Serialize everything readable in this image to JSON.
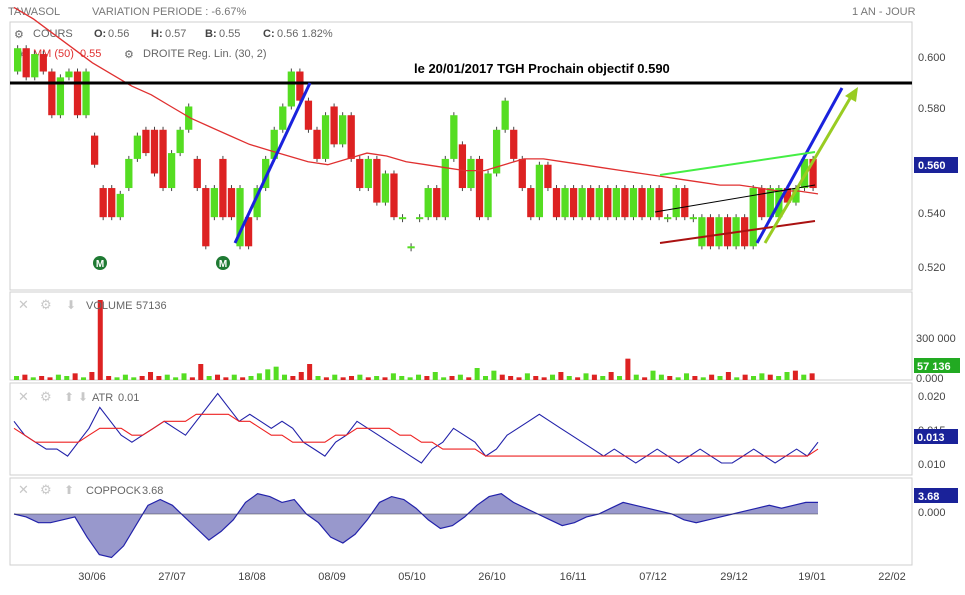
{
  "header": {
    "ticker": "TAWASOL",
    "variation": "VARIATION PERIODE : -6.67%",
    "period": "1 AN - JOUR"
  },
  "main_legend": {
    "cours": "COURS",
    "o_label": "O:",
    "o_value": "0.56",
    "h_label": "H:",
    "h_value": "0.57",
    "b_label": "B:",
    "b_value": "0.55",
    "c_label": "C:",
    "c_value": "0.56 1.82%",
    "mm": "MM (50)",
    "mm_value": "0.55",
    "droite": "DROITE Reg. Lin. (30, 2)"
  },
  "annotation": "le 20/01/2017 TGH Prochain objectif 0.590",
  "markers": [
    "M",
    "M"
  ],
  "colors": {
    "up": "#55dd22",
    "down": "#dd2222",
    "ma": "#e03030",
    "resistance": "#000000",
    "trend_blue": "#1a22dd",
    "trend_green_arrow": "#99cc22",
    "channel_top": "#44ee44",
    "channel_bottom": "#aa1111",
    "indicator_line": "#2222aa",
    "indicator_signal": "#ee2222",
    "coppock_fill": "#9898cc",
    "badge": "#1a2299",
    "badge_green": "#22aa22"
  },
  "x_ticks": [
    "30/06",
    "27/07",
    "18/08",
    "08/09",
    "05/10",
    "26/10",
    "16/11",
    "07/12",
    "29/12",
    "19/01",
    "22/02"
  ],
  "panels": {
    "price": {
      "y_ticks": [
        "0.600",
        "0.580",
        "0.560",
        "0.540",
        "0.520"
      ],
      "last": "0.560",
      "resistance": 0.59
    },
    "volume": {
      "label": "VOLUME",
      "value": "57136",
      "y_ticks": [
        "300 000",
        "0.000"
      ],
      "last": "57 136"
    },
    "atr": {
      "label": "ATR",
      "value": "0.01",
      "y_ticks": [
        "0.020",
        "0.015",
        "0.010"
      ],
      "last": "0.013"
    },
    "coppock": {
      "label": "COPPOCK",
      "value": "3.68",
      "y_ticks": [
        "0.000"
      ],
      "last": "3.68"
    }
  },
  "chart_data": {
    "type": "bar",
    "title": "TAWASOL",
    "price_ylim": [
      0.515,
      0.607
    ],
    "candles": [
      {
        "o": 0.59,
        "c": 0.598
      },
      {
        "o": 0.598,
        "c": 0.588
      },
      {
        "o": 0.588,
        "c": 0.596
      },
      {
        "o": 0.596,
        "c": 0.59
      },
      {
        "o": 0.59,
        "c": 0.575
      },
      {
        "o": 0.575,
        "c": 0.588
      },
      {
        "o": 0.588,
        "c": 0.59
      },
      {
        "o": 0.59,
        "c": 0.575
      },
      {
        "o": 0.575,
        "c": 0.59
      },
      {
        "o": 0.568,
        "c": 0.558
      },
      {
        "o": 0.55,
        "c": 0.54
      },
      {
        "o": 0.55,
        "c": 0.54
      },
      {
        "o": 0.54,
        "c": 0.548
      },
      {
        "o": 0.55,
        "c": 0.56
      },
      {
        "o": 0.56,
        "c": 0.568
      },
      {
        "o": 0.57,
        "c": 0.562
      },
      {
        "o": 0.57,
        "c": 0.555
      },
      {
        "o": 0.57,
        "c": 0.55
      },
      {
        "o": 0.55,
        "c": 0.562
      },
      {
        "o": 0.562,
        "c": 0.57
      },
      {
        "o": 0.57,
        "c": 0.578
      },
      {
        "o": 0.56,
        "c": 0.55
      },
      {
        "o": 0.55,
        "c": 0.53
      },
      {
        "o": 0.54,
        "c": 0.55
      },
      {
        "o": 0.56,
        "c": 0.54
      },
      {
        "o": 0.55,
        "c": 0.54
      },
      {
        "o": 0.53,
        "c": 0.55
      },
      {
        "o": 0.54,
        "c": 0.53
      },
      {
        "o": 0.54,
        "c": 0.55
      },
      {
        "o": 0.55,
        "c": 0.56
      },
      {
        "o": 0.56,
        "c": 0.57
      },
      {
        "o": 0.57,
        "c": 0.578
      },
      {
        "o": 0.578,
        "c": 0.59
      },
      {
        "o": 0.59,
        "c": 0.58
      },
      {
        "o": 0.58,
        "c": 0.57
      },
      {
        "o": 0.57,
        "c": 0.56
      },
      {
        "o": 0.56,
        "c": 0.575
      },
      {
        "o": 0.578,
        "c": 0.565
      },
      {
        "o": 0.565,
        "c": 0.575
      },
      {
        "o": 0.575,
        "c": 0.56
      },
      {
        "o": 0.56,
        "c": 0.55
      },
      {
        "o": 0.55,
        "c": 0.56
      },
      {
        "o": 0.56,
        "c": 0.545
      },
      {
        "o": 0.545,
        "c": 0.555
      },
      {
        "o": 0.555,
        "c": 0.54
      },
      {
        "o": 0.54,
        "c": 0.54
      },
      {
        "o": 0.53,
        "c": 0.53
      },
      {
        "o": 0.54,
        "c": 0.54
      },
      {
        "o": 0.54,
        "c": 0.55
      },
      {
        "o": 0.55,
        "c": 0.54
      },
      {
        "o": 0.54,
        "c": 0.56
      },
      {
        "o": 0.56,
        "c": 0.575
      },
      {
        "o": 0.565,
        "c": 0.55
      },
      {
        "o": 0.55,
        "c": 0.56
      },
      {
        "o": 0.56,
        "c": 0.54
      },
      {
        "o": 0.54,
        "c": 0.555
      },
      {
        "o": 0.555,
        "c": 0.57
      },
      {
        "o": 0.57,
        "c": 0.58
      },
      {
        "o": 0.57,
        "c": 0.56
      },
      {
        "o": 0.56,
        "c": 0.55
      },
      {
        "o": 0.55,
        "c": 0.54
      },
      {
        "o": 0.54,
        "c": 0.558
      },
      {
        "o": 0.558,
        "c": 0.55
      },
      {
        "o": 0.55,
        "c": 0.54
      },
      {
        "o": 0.54,
        "c": 0.55
      },
      {
        "o": 0.55,
        "c": 0.54
      },
      {
        "o": 0.54,
        "c": 0.55
      },
      {
        "o": 0.55,
        "c": 0.54
      },
      {
        "o": 0.54,
        "c": 0.55
      },
      {
        "o": 0.55,
        "c": 0.54
      },
      {
        "o": 0.54,
        "c": 0.55
      },
      {
        "o": 0.55,
        "c": 0.54
      },
      {
        "o": 0.54,
        "c": 0.55
      },
      {
        "o": 0.55,
        "c": 0.54
      },
      {
        "o": 0.54,
        "c": 0.55
      },
      {
        "o": 0.55,
        "c": 0.54
      },
      {
        "o": 0.54,
        "c": 0.54
      },
      {
        "o": 0.54,
        "c": 0.55
      },
      {
        "o": 0.55,
        "c": 0.54
      },
      {
        "o": 0.54,
        "c": 0.54
      },
      {
        "o": 0.53,
        "c": 0.54
      },
      {
        "o": 0.54,
        "c": 0.53
      },
      {
        "o": 0.53,
        "c": 0.54
      },
      {
        "o": 0.54,
        "c": 0.53
      },
      {
        "o": 0.53,
        "c": 0.54
      },
      {
        "o": 0.54,
        "c": 0.53
      },
      {
        "o": 0.53,
        "c": 0.55
      },
      {
        "o": 0.55,
        "c": 0.54
      },
      {
        "o": 0.54,
        "c": 0.55
      },
      {
        "o": 0.54,
        "c": 0.55
      },
      {
        "o": 0.55,
        "c": 0.545
      },
      {
        "o": 0.545,
        "c": 0.55
      },
      {
        "o": 0.55,
        "c": 0.56
      },
      {
        "o": 0.56,
        "c": 0.55
      }
    ],
    "ma50": [
      0.612,
      0.608,
      0.603,
      0.598,
      0.593,
      0.589,
      0.585,
      0.582,
      0.578,
      0.574,
      0.571,
      0.568,
      0.565,
      0.563,
      0.561,
      0.559,
      0.558,
      0.56,
      0.562,
      0.561,
      0.559,
      0.558,
      0.557,
      0.556,
      0.556,
      0.558,
      0.56,
      0.56,
      0.559,
      0.558,
      0.557,
      0.556,
      0.555,
      0.554,
      0.553,
      0.552,
      0.551,
      0.551,
      0.55,
      0.549,
      0.549,
      0.548
    ],
    "volume": [
      3,
      4,
      2,
      3,
      2,
      4,
      3,
      5,
      2,
      6,
      60,
      3,
      2,
      4,
      2,
      3,
      6,
      3,
      4,
      2,
      5,
      2,
      12,
      3,
      4,
      2,
      4,
      2,
      3,
      5,
      8,
      10,
      4,
      3,
      6,
      12,
      3,
      2,
      4,
      2,
      3,
      4,
      2,
      3,
      2,
      5,
      3,
      2,
      4,
      3,
      6,
      2,
      3,
      4,
      2,
      9,
      3,
      7,
      4,
      3,
      2,
      5,
      3,
      2,
      4,
      6,
      3,
      2,
      5,
      4,
      3,
      6,
      3,
      16,
      4,
      2,
      7,
      4,
      3,
      2,
      5,
      3,
      2,
      4,
      3,
      6,
      2,
      4,
      3,
      5,
      4,
      3,
      6,
      7,
      4,
      5
    ],
    "volume_max": 400000,
    "atr": [
      0.016,
      0.014,
      0.013,
      0.012,
      0.012,
      0.011,
      0.013,
      0.015,
      0.018,
      0.016,
      0.014,
      0.013,
      0.014,
      0.015,
      0.016,
      0.015,
      0.014,
      0.016,
      0.018,
      0.02,
      0.018,
      0.016,
      0.017,
      0.016,
      0.015,
      0.016,
      0.015,
      0.013,
      0.012,
      0.011,
      0.013,
      0.014,
      0.016,
      0.015,
      0.014,
      0.013,
      0.012,
      0.011,
      0.01,
      0.012,
      0.013,
      0.015,
      0.014,
      0.013,
      0.011,
      0.012,
      0.014,
      0.015,
      0.016,
      0.017,
      0.016,
      0.015,
      0.014,
      0.013,
      0.012,
      0.011,
      0.012,
      0.011,
      0.01,
      0.011,
      0.012,
      0.011,
      0.01,
      0.011,
      0.012,
      0.011,
      0.01,
      0.01,
      0.011,
      0.012,
      0.011,
      0.01,
      0.011,
      0.012,
      0.011,
      0.013
    ],
    "atr_signal": [
      0.015,
      0.014,
      0.013,
      0.013,
      0.013,
      0.013,
      0.013,
      0.014,
      0.015,
      0.015,
      0.015,
      0.014,
      0.014,
      0.015,
      0.016,
      0.016,
      0.016,
      0.017,
      0.017,
      0.017,
      0.017,
      0.016,
      0.016,
      0.015,
      0.014,
      0.014,
      0.013,
      0.013,
      0.013,
      0.013,
      0.014,
      0.014,
      0.015,
      0.015,
      0.015,
      0.015,
      0.014,
      0.014,
      0.013,
      0.013,
      0.012,
      0.012,
      0.012,
      0.012,
      0.011,
      0.011,
      0.011,
      0.011,
      0.011,
      0.011,
      0.011,
      0.011,
      0.011,
      0.011,
      0.011,
      0.011,
      0.011,
      0.011,
      0.011,
      0.011,
      0.011,
      0.011,
      0.011,
      0.011,
      0.011,
      0.011,
      0.011,
      0.011,
      0.011,
      0.011,
      0.011,
      0.011,
      0.011,
      0.011,
      0.011,
      0.012
    ],
    "coppock": [
      0,
      -1,
      -3,
      -3,
      -2,
      -1,
      -8,
      -14,
      -15,
      -11,
      -4,
      3,
      5,
      3,
      -1,
      -5,
      -9,
      -6,
      -2,
      4,
      7,
      6,
      4,
      5,
      0,
      -3,
      -8,
      -10,
      -7,
      -2,
      4,
      6,
      5,
      2,
      -2,
      -5,
      -4,
      -1,
      3,
      6,
      7,
      4,
      2,
      0,
      -2,
      -4,
      -3,
      -1,
      0,
      2,
      4,
      3,
      2,
      1,
      0,
      -2,
      -3,
      -2,
      -1,
      0,
      1,
      2,
      3,
      2,
      3,
      4,
      4
    ]
  }
}
